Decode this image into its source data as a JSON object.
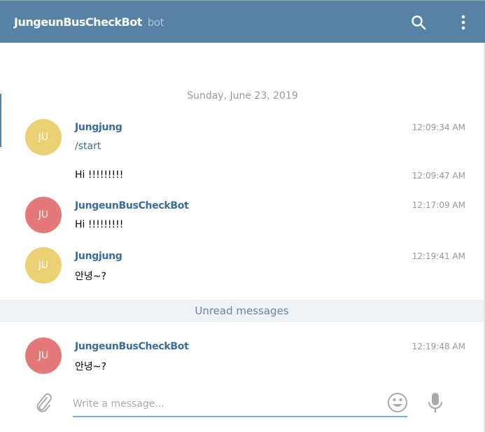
{
  "header": {
    "title": "JungeunBusCheckBot",
    "subtitle": "bot"
  },
  "date_separator": "Sunday, June 23, 2019",
  "messages": [
    {
      "avatar": "JU",
      "avatar_color": "#ecd074",
      "name": "Jungjung",
      "text": "/start",
      "time": "12:09:34 AM"
    },
    {
      "text": "Hi !!!!!!!!!",
      "time": "12:09:47 AM"
    },
    {
      "avatar": "JU",
      "avatar_color": "#e57979",
      "name": "JungeunBusCheckBot",
      "text": "Hi !!!!!!!!!",
      "time": "12:17:09 AM"
    },
    {
      "avatar": "JU",
      "avatar_color": "#ecd074",
      "name": "Jungjung",
      "text": "안녕~?",
      "time": "12:19:41 AM"
    },
    {
      "avatar": "JU",
      "avatar_color": "#e57979",
      "name": "JungeunBusCheckBot",
      "text": "안녕~?",
      "time": "12:19:48 AM"
    }
  ],
  "unread_label": "Unread messages",
  "composer": {
    "placeholder": "Write a message..."
  }
}
